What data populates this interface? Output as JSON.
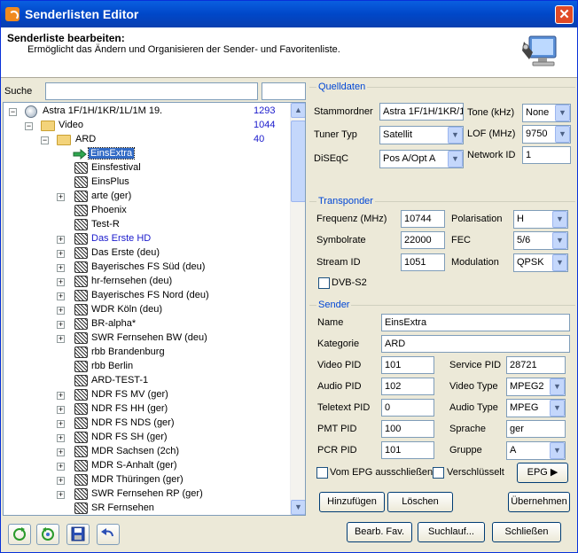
{
  "window": {
    "title": "Senderlisten Editor",
    "close_glyph": "✕"
  },
  "header": {
    "title": "Senderliste bearbeiten:",
    "subtitle": "Ermöglicht das Ändern und Organisieren der Sender- und Favoritenliste."
  },
  "search": {
    "label": "Suche",
    "value": "",
    "value2": ""
  },
  "tree": {
    "root": {
      "label": "Astra 1F/1H/1KR/1L/1M 19.",
      "count": "1293"
    },
    "video": {
      "label": "Video",
      "count": "1044"
    },
    "ard": {
      "label": "ARD",
      "count": "40"
    },
    "channels": [
      {
        "label": "EinsExtra",
        "selected": true,
        "expandable": false,
        "blue": false
      },
      {
        "label": "Einsfestival",
        "expandable": false,
        "blue": false
      },
      {
        "label": "EinsPlus",
        "expandable": false,
        "blue": false
      },
      {
        "label": "arte (ger)",
        "expandable": true,
        "blue": false
      },
      {
        "label": "Phoenix",
        "expandable": false,
        "blue": false
      },
      {
        "label": "Test-R",
        "expandable": false,
        "blue": false
      },
      {
        "label": "Das Erste HD",
        "expandable": true,
        "blue": true
      },
      {
        "label": "Das Erste (deu)",
        "expandable": true,
        "blue": false
      },
      {
        "label": "Bayerisches FS Süd (deu)",
        "expandable": true,
        "blue": false
      },
      {
        "label": "hr-fernsehen (deu)",
        "expandable": true,
        "blue": false
      },
      {
        "label": "Bayerisches FS Nord (deu)",
        "expandable": true,
        "blue": false
      },
      {
        "label": "WDR Köln (deu)",
        "expandable": true,
        "blue": false
      },
      {
        "label": "BR-alpha*",
        "expandable": true,
        "blue": false
      },
      {
        "label": "SWR Fernsehen BW (deu)",
        "expandable": true,
        "blue": false
      },
      {
        "label": "rbb Brandenburg",
        "expandable": false,
        "blue": false
      },
      {
        "label": "rbb Berlin",
        "expandable": false,
        "blue": false
      },
      {
        "label": "ARD-TEST-1",
        "expandable": false,
        "blue": false
      },
      {
        "label": "NDR FS MV (ger)",
        "expandable": true,
        "blue": false
      },
      {
        "label": "NDR FS HH (ger)",
        "expandable": true,
        "blue": false
      },
      {
        "label": "NDR FS NDS (ger)",
        "expandable": true,
        "blue": false
      },
      {
        "label": "NDR FS SH (ger)",
        "expandable": true,
        "blue": false
      },
      {
        "label": "MDR Sachsen (2ch)",
        "expandable": true,
        "blue": false
      },
      {
        "label": "MDR S-Anhalt (ger)",
        "expandable": true,
        "blue": false
      },
      {
        "label": "MDR Thüringen (ger)",
        "expandable": true,
        "blue": false
      },
      {
        "label": "SWR Fernsehen RP (ger)",
        "expandable": true,
        "blue": false
      },
      {
        "label": "SR Fernsehen",
        "expandable": false,
        "blue": false
      }
    ]
  },
  "quelldaten": {
    "title": "Quelldaten",
    "stammordner_label": "Stammordner",
    "stammordner_value": "Astra 1F/1H/1KR/1",
    "tuner_label": "Tuner Typ",
    "tuner_value": "Satellit",
    "diseqc_label": "DiSEqC",
    "diseqc_value": "Pos A/Opt A",
    "tone_label": "Tone (kHz)",
    "tone_value": "None",
    "lof_label": "LOF (MHz)",
    "lof_value": "9750",
    "network_label": "Network ID",
    "network_value": "1"
  },
  "transponder": {
    "title": "Transponder",
    "freq_label": "Frequenz (MHz)",
    "freq_value": "10744",
    "symbol_label": "Symbolrate",
    "symbol_value": "22000",
    "stream_label": "Stream ID",
    "stream_value": "1051",
    "pol_label": "Polarisation",
    "pol_value": "H",
    "fec_label": "FEC",
    "fec_value": "5/6",
    "mod_label": "Modulation",
    "mod_value": "QPSK",
    "dvbs2_label": "DVB-S2"
  },
  "sender": {
    "title": "Sender",
    "name_label": "Name",
    "name_value": "EinsExtra",
    "kategorie_label": "Kategorie",
    "kategorie_value": "ARD",
    "video_pid_label": "Video PID",
    "video_pid_value": "101",
    "audio_pid_label": "Audio PID",
    "audio_pid_value": "102",
    "teletext_label": "Teletext PID",
    "teletext_value": "0",
    "pmt_label": "PMT PID",
    "pmt_value": "100",
    "pcr_label": "PCR PID",
    "pcr_value": "101",
    "service_label": "Service PID",
    "service_value": "28721",
    "video_type_label": "Video Type",
    "video_type_value": "MPEG2",
    "audio_type_label": "Audio Type",
    "audio_type_value": "MPEG",
    "sprache_label": "Sprache",
    "sprache_value": "ger",
    "gruppe_label": "Gruppe",
    "gruppe_value": "A",
    "epg_exclude_label": "Vom EPG ausschließen",
    "encrypted_label": "Verschlüsselt",
    "epg_button": "EPG"
  },
  "actions": {
    "add": "Hinzufügen",
    "delete": "Löschen",
    "apply": "Übernehmen"
  },
  "footer": {
    "fav": "Bearb. Fav.",
    "scan": "Suchlauf...",
    "close": "Schließen"
  }
}
